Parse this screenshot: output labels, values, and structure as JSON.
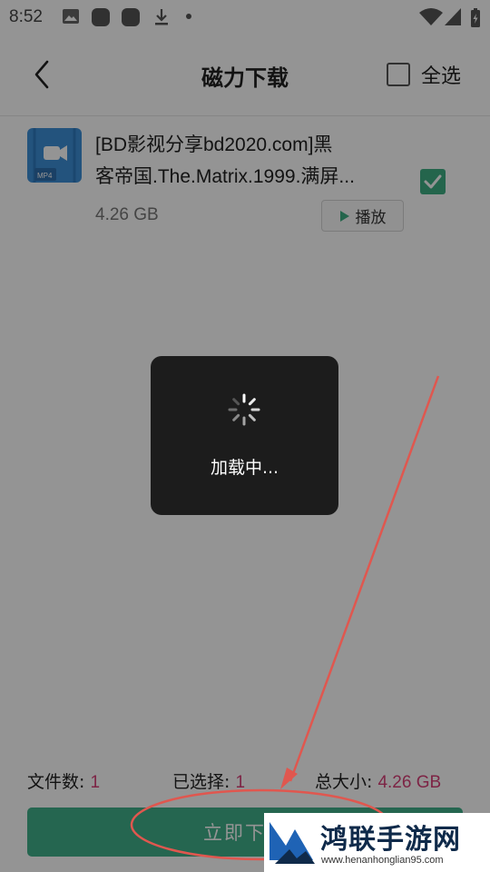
{
  "status_bar": {
    "time": "8:52",
    "left_icons": [
      "image-icon",
      "app-icon",
      "app-icon",
      "download-icon",
      "dot-icon"
    ],
    "right_icons": [
      "wifi-icon",
      "signal-icon",
      "battery-icon"
    ]
  },
  "header": {
    "back_icon": "back-arrow-icon",
    "title": "磁力下载",
    "select_all_label": "全选"
  },
  "file_item": {
    "thumb_icon": "mp4-video-icon",
    "thumb_badge": "MP4",
    "name_line1": "[BD影视分享bd2020.com]黑",
    "name_line2": "客帝国.The.Matrix.1999.满屏...",
    "size": "4.26 GB",
    "play_label": "播放",
    "checked": true
  },
  "stats": {
    "files_label": "文件数: ",
    "files_value": "1",
    "selected_label": "已选择: ",
    "selected_value": "1",
    "total_label": "总大小: ",
    "total_value": "4.26 GB"
  },
  "download_button": {
    "label": "立即下载"
  },
  "loading": {
    "text": "加载中..."
  },
  "watermark": {
    "title": "鸿联手游网",
    "url": "www.henanhonglian95.com"
  },
  "colors": {
    "accent": "#40b08a",
    "value_pink": "#d83f77",
    "annotation_red": "#e0574f",
    "toast_bg": "#1c1c1c"
  }
}
